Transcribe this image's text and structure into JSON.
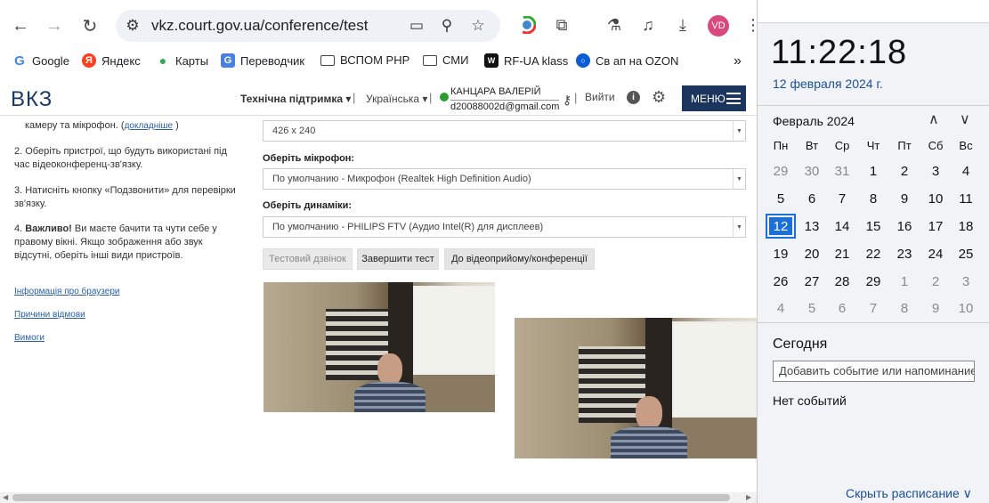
{
  "browser": {
    "url": "vkz.court.gov.ua/conference/test",
    "avatar_initials": "VD",
    "bookmarks": [
      "Google",
      "Яндекс",
      "Карты",
      "Переводчик",
      "ВСПОМ PHP",
      "СМИ",
      "RF-UA klass",
      "Св ап на OZON"
    ],
    "bookmarks_more": "»",
    "icons": {
      "back": "←",
      "forward": "→",
      "reload": "↻",
      "site-settings": "⚙",
      "camera": "▭",
      "zoom": "⚲",
      "star": "☆",
      "extension": "⧉",
      "lab": "⚗",
      "media": "♫",
      "download": "⤓",
      "menu": "⋮"
    }
  },
  "header": {
    "logo": "ВКЗ",
    "support": "Технічна підтримка ▾",
    "language": "Українська ▾",
    "separator": "|",
    "user_name": "КАНЦАРА ВАЛЕРІЙ",
    "user_email": "d20088002d@gmail.com",
    "logout": "Вийти",
    "menu_label": "МЕНЮ"
  },
  "instructions": {
    "step1_tail": "камеру та мікрофон. (",
    "step1_link": "докладніше",
    "step1_close": " )",
    "step2": "2. Оберіть пристрої, що будуть використані під час відеоконференц-зв'язку.",
    "step3": "3. Натисніть кнопку «Подзвонити» для перевірки зв'язку.",
    "step4_bold": "Важливо!",
    "step4_prefix": "4. ",
    "step4_rest": " Ви маєте бачити та чути себе у правому вікні. Якщо зображення або звук відсутні, оберіть інші види пристроїв.",
    "links": [
      "Інформація про браузери",
      "Причини відмови",
      "Вимоги"
    ]
  },
  "form": {
    "resolution": "426 x 240",
    "mic_label": "Оберіть мікрофон:",
    "mic_value": "По умолчанию - Микрофон (Realtek High Definition Audio)",
    "speaker_label": "Оберіть динаміки:",
    "speaker_value": "По умолчанию - PHILIPS FTV (Аудио Intel(R) для дисплеев)",
    "buttons": [
      "Тестовий дзвінок",
      "Завершити тест",
      "До відеоприйому/конференції"
    ]
  },
  "flyout": {
    "time": "11:22:18",
    "date": "12 февраля 2024 г.",
    "month": "Февраль 2024",
    "weekdays": [
      "Пн",
      "Вт",
      "Ср",
      "Чт",
      "Пт",
      "Сб",
      "Вс"
    ],
    "weeks": [
      [
        "29",
        "30",
        "31",
        "1",
        "2",
        "3",
        "4"
      ],
      [
        "5",
        "6",
        "7",
        "8",
        "9",
        "10",
        "11"
      ],
      [
        "12",
        "13",
        "14",
        "15",
        "16",
        "17",
        "18"
      ],
      [
        "19",
        "20",
        "21",
        "22",
        "23",
        "24",
        "25"
      ],
      [
        "26",
        "27",
        "28",
        "29",
        "1",
        "2",
        "3"
      ],
      [
        "4",
        "5",
        "6",
        "7",
        "8",
        "9",
        "10"
      ]
    ],
    "today_label": "Сегодня",
    "event_placeholder": "Добавить событие или напоминание",
    "no_events": "Нет событий",
    "schedule_link": "Скрыть расписание ∨",
    "arrow_up": "∧",
    "arrow_down": "∨"
  }
}
